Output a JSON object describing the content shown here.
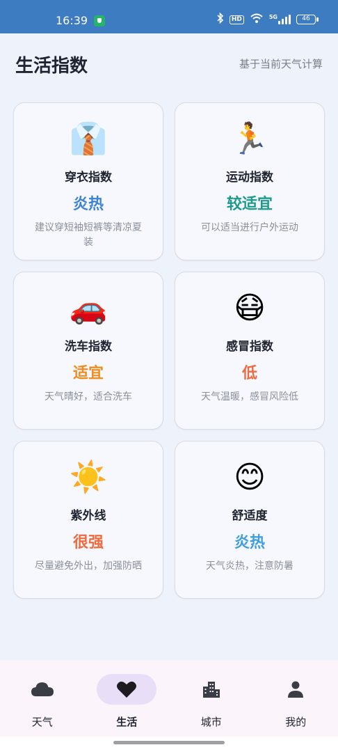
{
  "status_bar": {
    "time": "16:39",
    "hd": "HD",
    "network": "5G",
    "battery": "46",
    "icons": [
      "shield-icon",
      "bluetooth-icon",
      "wifi-icon",
      "signal-icon",
      "battery-icon"
    ]
  },
  "header": {
    "title": "生活指数",
    "subtitle": "基于当前天气计算"
  },
  "cards": [
    {
      "emoji": "👔",
      "icon": "shirt-tie-icon",
      "name": "穿衣指数",
      "level": "炎热",
      "level_color": "#3f82d4",
      "desc": "建议穿短袖短裤等清凉夏装"
    },
    {
      "emoji": "🏃",
      "icon": "runner-icon",
      "name": "运动指数",
      "level": "较适宜",
      "level_color": "#1e9a8c",
      "desc": "可以适当进行户外运动"
    },
    {
      "emoji": "🚗",
      "icon": "car-icon",
      "name": "洗车指数",
      "level": "适宜",
      "level_color": "#ef8c1d",
      "desc": "天气晴好，适合洗车"
    },
    {
      "emoji": "😷",
      "icon": "mask-face-icon",
      "name": "感冒指数",
      "level": "低",
      "level_color": "#ef6a3f",
      "desc": "天气温暖，感冒风险低"
    },
    {
      "emoji": "☀️",
      "icon": "sun-icon",
      "name": "紫外线",
      "level": "很强",
      "level_color": "#ef6a3f",
      "desc": "尽量避免外出，加强防晒"
    },
    {
      "emoji": "😊",
      "icon": "smile-face-icon",
      "name": "舒适度",
      "level": "炎热",
      "level_color": "#3f9de0",
      "desc": "天气炎热，注意防暑"
    }
  ],
  "bottom_nav": [
    {
      "label": "天气",
      "icon": "cloud-icon",
      "active": false
    },
    {
      "label": "生活",
      "icon": "heart-icon",
      "active": true
    },
    {
      "label": "城市",
      "icon": "city-icon",
      "active": false
    },
    {
      "label": "我的",
      "icon": "person-icon",
      "active": false
    }
  ],
  "colors": {
    "status_bar": "#3d7cc0",
    "background": "#eef2fb",
    "nav_active_pill": "#e8def8"
  }
}
